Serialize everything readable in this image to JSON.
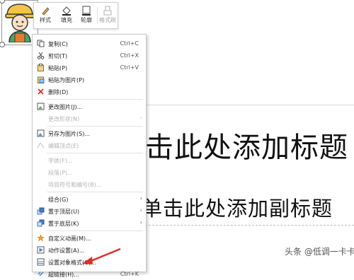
{
  "slide": {
    "title_placeholder": "击此处添加标题",
    "subtitle_placeholder": "单击此处添加副标题"
  },
  "mini_toolbar": {
    "style_label": "样式",
    "fill_label": "填充",
    "outline_label": "轮廓",
    "format_painter_label": "格式刷"
  },
  "context_menu": {
    "items": [
      {
        "label": "复制(C)",
        "shortcut": "Ctrl+C",
        "icon": "copy-icon",
        "disabled": false
      },
      {
        "label": "剪切(T)",
        "shortcut": "Ctrl+X",
        "icon": "scissors-icon",
        "disabled": false
      },
      {
        "label": "粘贴(P)",
        "shortcut": "Ctrl+V",
        "icon": "paste-icon",
        "disabled": false
      },
      {
        "label": "粘贴为图片(P)",
        "shortcut": "",
        "icon": "paste-picture-icon",
        "disabled": false
      },
      {
        "label": "删除(D)",
        "shortcut": "",
        "icon": "delete-x-icon",
        "disabled": false
      },
      {
        "label": "更改图片(J)...",
        "shortcut": "",
        "icon": "change-picture-icon",
        "disabled": false
      },
      {
        "label": "更改形状(N)",
        "shortcut": "",
        "icon": "",
        "disabled": true,
        "submenu": true
      },
      {
        "label": "另存为图片(S)...",
        "shortcut": "",
        "icon": "save-picture-icon",
        "disabled": false
      },
      {
        "label": "编辑顶点(E)",
        "shortcut": "",
        "icon": "edit-points-icon",
        "disabled": true
      },
      {
        "label": "字体(F)...",
        "shortcut": "",
        "icon": "",
        "disabled": true
      },
      {
        "label": "段落(P)...",
        "shortcut": "",
        "icon": "",
        "disabled": true
      },
      {
        "label": "项目符号和编号(B)...",
        "shortcut": "",
        "icon": "",
        "disabled": true
      },
      {
        "label": "组合(G)",
        "shortcut": "",
        "icon": "",
        "disabled": false,
        "submenu": true
      },
      {
        "label": "置于顶层(U)",
        "shortcut": "",
        "icon": "bring-front-icon",
        "disabled": false,
        "submenu": true
      },
      {
        "label": "置于底层(K)",
        "shortcut": "",
        "icon": "send-back-icon",
        "disabled": false,
        "submenu": true
      },
      {
        "label": "自定义动画(M)...",
        "shortcut": "",
        "icon": "animation-icon",
        "disabled": false
      },
      {
        "label": "动作设置(A)...",
        "shortcut": "",
        "icon": "action-icon",
        "disabled": false
      },
      {
        "label": "设置对象格式(O)...",
        "shortcut": "",
        "icon": "format-object-icon",
        "disabled": false
      },
      {
        "label": "超链接(H)...",
        "shortcut": "Ctrl+K",
        "icon": "hyperlink-icon",
        "disabled": false
      }
    ]
  },
  "watermark": {
    "text": "头条 @低调一卡卡"
  },
  "colors": {
    "accent_red": "#d9322b",
    "menu_text": "#222222",
    "disabled_text": "#b4b4b4"
  }
}
